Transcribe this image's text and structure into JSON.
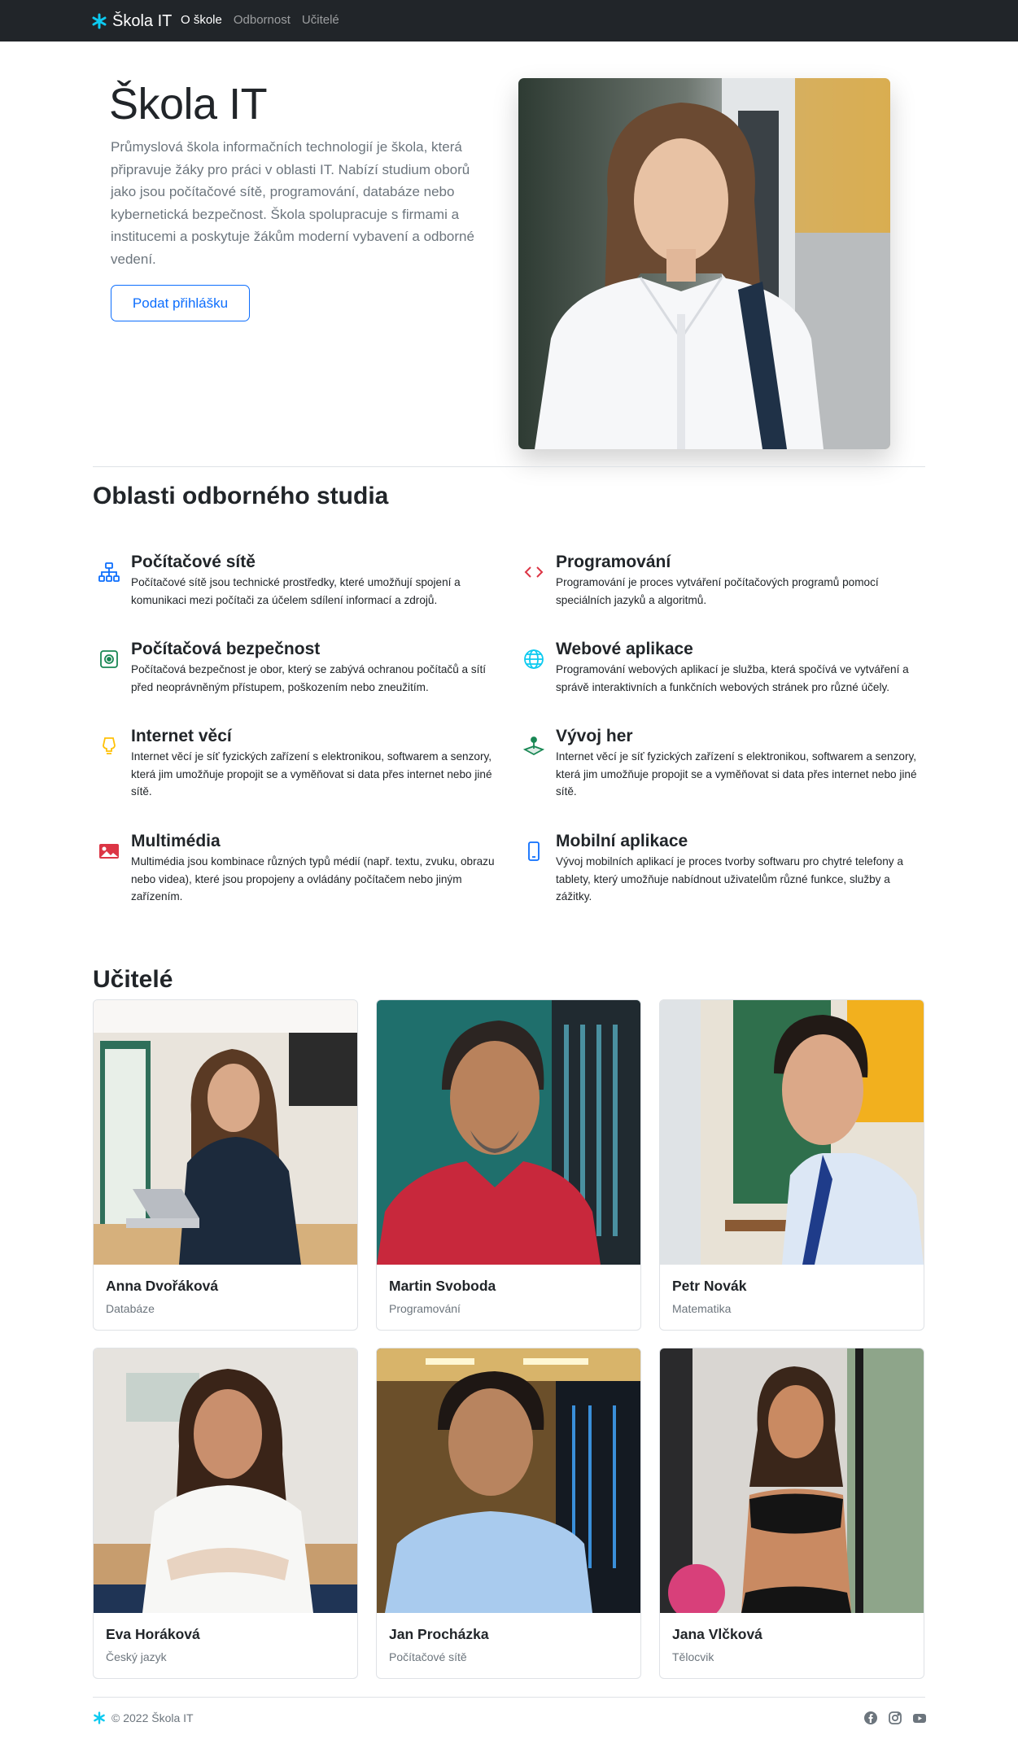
{
  "navbar": {
    "brand": "Škola IT",
    "links": [
      "O škole",
      "Odbornost",
      "Učitelé"
    ]
  },
  "hero": {
    "title": "Škola IT",
    "lead": "Průmyslová škola informačních technologií je škola, která připravuje žáky pro práci v oblasti IT. Nabízí studium oborů jako jsou počítačové sítě, programování, databáze nebo kybernetická bezpečnost. Škola spolupracuje s firmami a institucemi a poskytuje žákům moderní vybavení a odborné vedení.",
    "button": "Podat přihlášku"
  },
  "features": {
    "title": "Oblasti odborného studia",
    "items": [
      {
        "icon": "network-icon",
        "color": "#0d6efd",
        "title": "Počítačové sítě",
        "text": "Počítačové sítě jsou technické prostředky, které umožňují spojení a komunikaci mezi počítači za účelem sdílení informací a zdrojů."
      },
      {
        "icon": "code-icon",
        "color": "#dc3545",
        "title": "Programování",
        "text": "Programování je proces vytváření počítačových programů pomocí speciálních jazyků a algoritmů."
      },
      {
        "icon": "shield-cpu-icon",
        "color": "#198754",
        "title": "Počítačová bezpečnost",
        "text": "Počítačová bezpečnost je obor, který se zabývá ochranou počítačů a sítí před neoprávněným přístupem, poškozením nebo zneužitím."
      },
      {
        "icon": "globe-icon",
        "color": "#0dcaf0",
        "title": "Webové aplikace",
        "text": "Programování webových aplikací je služba, která spočívá ve vytváření a správě interaktivních a funkčních webových stránek pro různé účely."
      },
      {
        "icon": "lightbulb-icon",
        "color": "#ffc107",
        "title": "Internet věcí",
        "text": "Internet věcí je síť fyzických zařízení s elektronikou, softwarem a senzory, která jim umožňuje propojit se a vyměňovat si data přes internet nebo jiné sítě."
      },
      {
        "icon": "joystick-icon",
        "color": "#198754",
        "title": "Vývoj her",
        "text": "Internet věcí je síť fyzických zařízení s elektronikou, softwarem a senzory, která jim umožňuje propojit se a vyměňovat si data přes internet nebo jiné sítě."
      },
      {
        "icon": "image-icon",
        "color": "#dc3545",
        "title": "Multimédia",
        "text": "Multimédia jsou kombinace různých typů médií (např. textu, zvuku, obrazu nebo videa), které jsou propojeny a ovládány počítačem nebo jiným zařízením."
      },
      {
        "icon": "phone-icon",
        "color": "#0d6efd",
        "title": "Mobilní aplikace",
        "text": "Vývoj mobilních aplikací je proces tvorby softwaru pro chytré telefony a tablety, který umožňuje nabídnout uživatelům různé funkce, služby a zážitky."
      }
    ]
  },
  "teachers": {
    "title": "Učitelé",
    "items": [
      {
        "name": "Anna Dvořáková",
        "subject": "Databáze"
      },
      {
        "name": "Martin Svoboda",
        "subject": "Programování"
      },
      {
        "name": "Petr Novák",
        "subject": "Matematika"
      },
      {
        "name": "Eva Horáková",
        "subject": "Český jazyk"
      },
      {
        "name": "Jan Procházka",
        "subject": "Počítačové sítě"
      },
      {
        "name": "Jana Vlčková",
        "subject": "Tělocvik"
      }
    ]
  },
  "footer": {
    "copyright": "© 2022 Škola IT",
    "social": [
      "facebook-icon",
      "instagram-icon",
      "youtube-icon"
    ]
  },
  "colors": {
    "navbar": "#212529",
    "accent": "#0d6efd",
    "logo": "#0dcaf0"
  }
}
